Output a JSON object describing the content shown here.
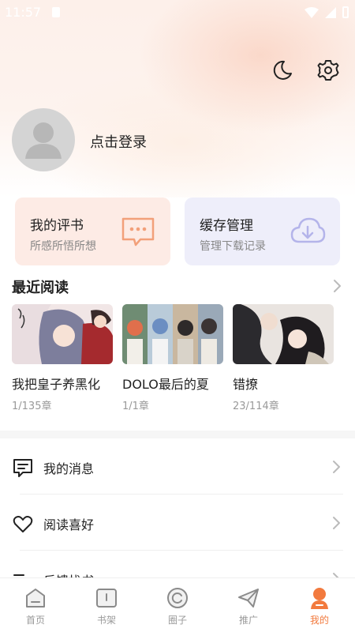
{
  "status_bar": {
    "time": "11:57"
  },
  "profile": {
    "login_label": "点击登录"
  },
  "cards": [
    {
      "title": "我的评书",
      "subtitle": "所感所悟所想",
      "icon": "comment-dots-icon"
    },
    {
      "title": "缓存管理",
      "subtitle": "管理下载记录",
      "icon": "cloud-download-icon"
    }
  ],
  "recent": {
    "title": "最近阅读",
    "books": [
      {
        "title": "我把皇子养黑化",
        "progress": "1/135章"
      },
      {
        "title": "DOLO最后的夏",
        "progress": "1/1章"
      },
      {
        "title": "错撩",
        "progress": "23/114章"
      }
    ]
  },
  "menu": [
    {
      "label": "我的消息",
      "icon": "message-icon"
    },
    {
      "label": "阅读喜好",
      "icon": "heart-icon"
    },
    {
      "label": "反馈找书",
      "icon": "list-search-icon"
    }
  ],
  "nav": [
    {
      "label": "首页",
      "icon": "home-icon"
    },
    {
      "label": "书架",
      "icon": "bookshelf-icon"
    },
    {
      "label": "圈子",
      "icon": "circle-icon"
    },
    {
      "label": "推广",
      "icon": "paper-plane-icon"
    },
    {
      "label": "我的",
      "icon": "person-icon",
      "active": true
    }
  ],
  "colors": {
    "accent": "#f27a3e",
    "review_card": "#fdebe5",
    "cache_card": "#eeeefa"
  }
}
